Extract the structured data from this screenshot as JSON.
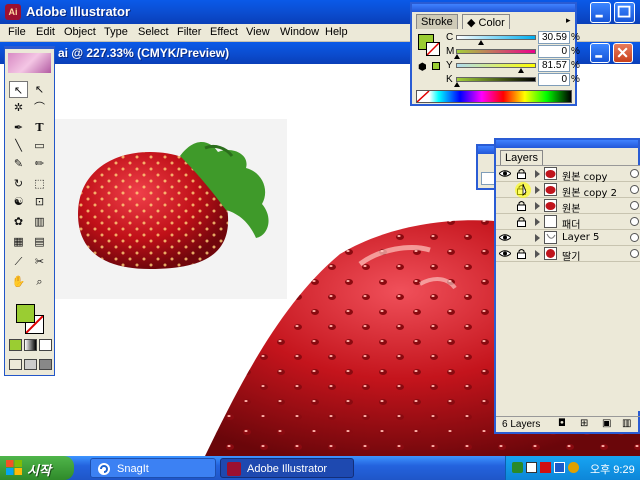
{
  "app": {
    "title": "Adobe Illustrator",
    "icon_text": "Ai"
  },
  "menu": [
    "File",
    "Edit",
    "Object",
    "Type",
    "Select",
    "Filter",
    "Effect",
    "View",
    "Window",
    "Help"
  ],
  "document": {
    "title": "ai @ 227.33% (CMYK/Preview)"
  },
  "colors": {
    "fill": "#9acd32",
    "xp_blue": "#0b4ccf",
    "strawberry": "#c0141c"
  },
  "color_panel": {
    "tabs": [
      "Stroke",
      "Color"
    ],
    "active_tab": "Color",
    "channels": [
      {
        "label": "C",
        "value": "30.59",
        "unit": "%",
        "fraction": 0.31
      },
      {
        "label": "M",
        "value": "0",
        "unit": "%",
        "fraction": 0.0
      },
      {
        "label": "Y",
        "value": "81.57",
        "unit": "%",
        "fraction": 0.82
      },
      {
        "label": "K",
        "value": "0",
        "unit": "%",
        "fraction": 0.0
      }
    ]
  },
  "layers_panel": {
    "tab": "Layers",
    "layers": [
      {
        "name": "원본 copy",
        "visible": true,
        "locked": true
      },
      {
        "name": "원본 copy 2",
        "visible": false,
        "locked": true
      },
      {
        "name": "원본",
        "visible": false,
        "locked": true
      },
      {
        "name": "패더",
        "visible": false,
        "locked": true
      },
      {
        "name": "Layer 5",
        "visible": true,
        "locked": false
      },
      {
        "name": "딸기",
        "visible": true,
        "locked": true
      }
    ],
    "footer": "6 Layers"
  },
  "taskbar": {
    "start_label": "시작",
    "tasks": [
      {
        "label": "SnagIt",
        "active": false
      },
      {
        "label": "Adobe Illustrator",
        "active": true
      }
    ],
    "clock": "오후 9:29"
  }
}
